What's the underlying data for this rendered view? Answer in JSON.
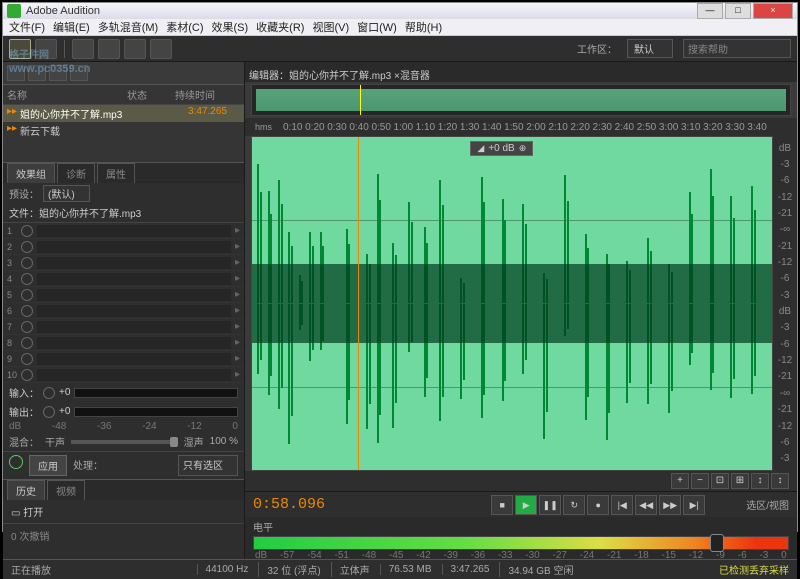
{
  "window": {
    "title": "Adobe Audition"
  },
  "menu": [
    "文件(F)",
    "编辑(E)",
    "多轨混音(M)",
    "素材(C)",
    "效果(S)",
    "收藏夹(R)",
    "视图(V)",
    "窗口(W)",
    "帮助(H)"
  ],
  "workspace": {
    "label": "工作区：",
    "value": "默认",
    "search_placeholder": "搜索帮助"
  },
  "watermark": {
    "main": "格子件网",
    "url": "www.pc0359.cn"
  },
  "files": {
    "cols": {
      "name": "名称",
      "status": "状态",
      "duration": "持续时间"
    },
    "rows": [
      {
        "name": "姐的心你并不了解.mp3",
        "status": "",
        "duration": "3:47.265",
        "selected": true
      },
      {
        "name": "新云下载",
        "status": "",
        "duration": "",
        "selected": false
      }
    ]
  },
  "effects": {
    "tabs": [
      "效果组",
      "诊断",
      "属性"
    ],
    "preset_label": "预设：",
    "preset_value": "(默认)",
    "file_label": "文件：",
    "file_value": "姐的心你并不了解.mp3",
    "slots": [
      1,
      2,
      3,
      4,
      5,
      6,
      7,
      8,
      9,
      10
    ],
    "input_label": "输入：",
    "input_db": "+0",
    "output_label": "输出：",
    "output_db": "+0",
    "mix_label": "混合：",
    "mix_dry": "干声",
    "mix_wet": "湿声",
    "mix_pct": "100 %",
    "db_marks": [
      "dB",
      "-48",
      "-36",
      "-24",
      "-12",
      "0"
    ],
    "apply": "应用",
    "process_label": "处理：",
    "process_value": "只有选区"
  },
  "history": {
    "tabs": [
      "历史",
      "视频"
    ],
    "item": "打开",
    "undo": "0 次撤销"
  },
  "editor": {
    "tab_prefix": "编辑器：",
    "tab_file": "姐的心你并不了解.mp3",
    "tab_other": "混音器",
    "hms": "hms",
    "time_ticks": [
      "0:10",
      "0:20",
      "0:30",
      "0:40",
      "0:50",
      "1:00",
      "1:10",
      "1:20",
      "1:30",
      "1:40",
      "1:50",
      "2:00",
      "2:10",
      "2:20",
      "2:30",
      "2:40",
      "2:50",
      "3:00",
      "3:10",
      "3:20",
      "3:30",
      "3:40"
    ],
    "db_ticks": [
      "dB",
      "-3",
      "-6",
      "-12",
      "-21",
      "-∞",
      "-21",
      "-12",
      "-6",
      "-3",
      "dB",
      "-3",
      "-6",
      "-12",
      "-21",
      "-∞",
      "-21",
      "-12",
      "-6",
      "-3"
    ],
    "vol_badge": "+0 dB",
    "timecode": "0:58.096",
    "sel_label": "选区/视图"
  },
  "levels": {
    "tab": "电平",
    "scale": [
      "dB",
      "-57",
      "-54",
      "-51",
      "-48",
      "-45",
      "-42",
      "-39",
      "-36",
      "-33",
      "-30",
      "-27",
      "-24",
      "-21",
      "-18",
      "-15",
      "-12",
      "-9",
      "-6",
      "-3",
      "0"
    ]
  },
  "status": {
    "playing": "正在播放",
    "sr": "44100 Hz",
    "bit": "32 位 (浮点)",
    "stereo": "立体声",
    "size": "76.53 MB",
    "dur": "3:47.265",
    "free": "34.94 GB 空闲",
    "warn": "已检测丢弃采样"
  }
}
